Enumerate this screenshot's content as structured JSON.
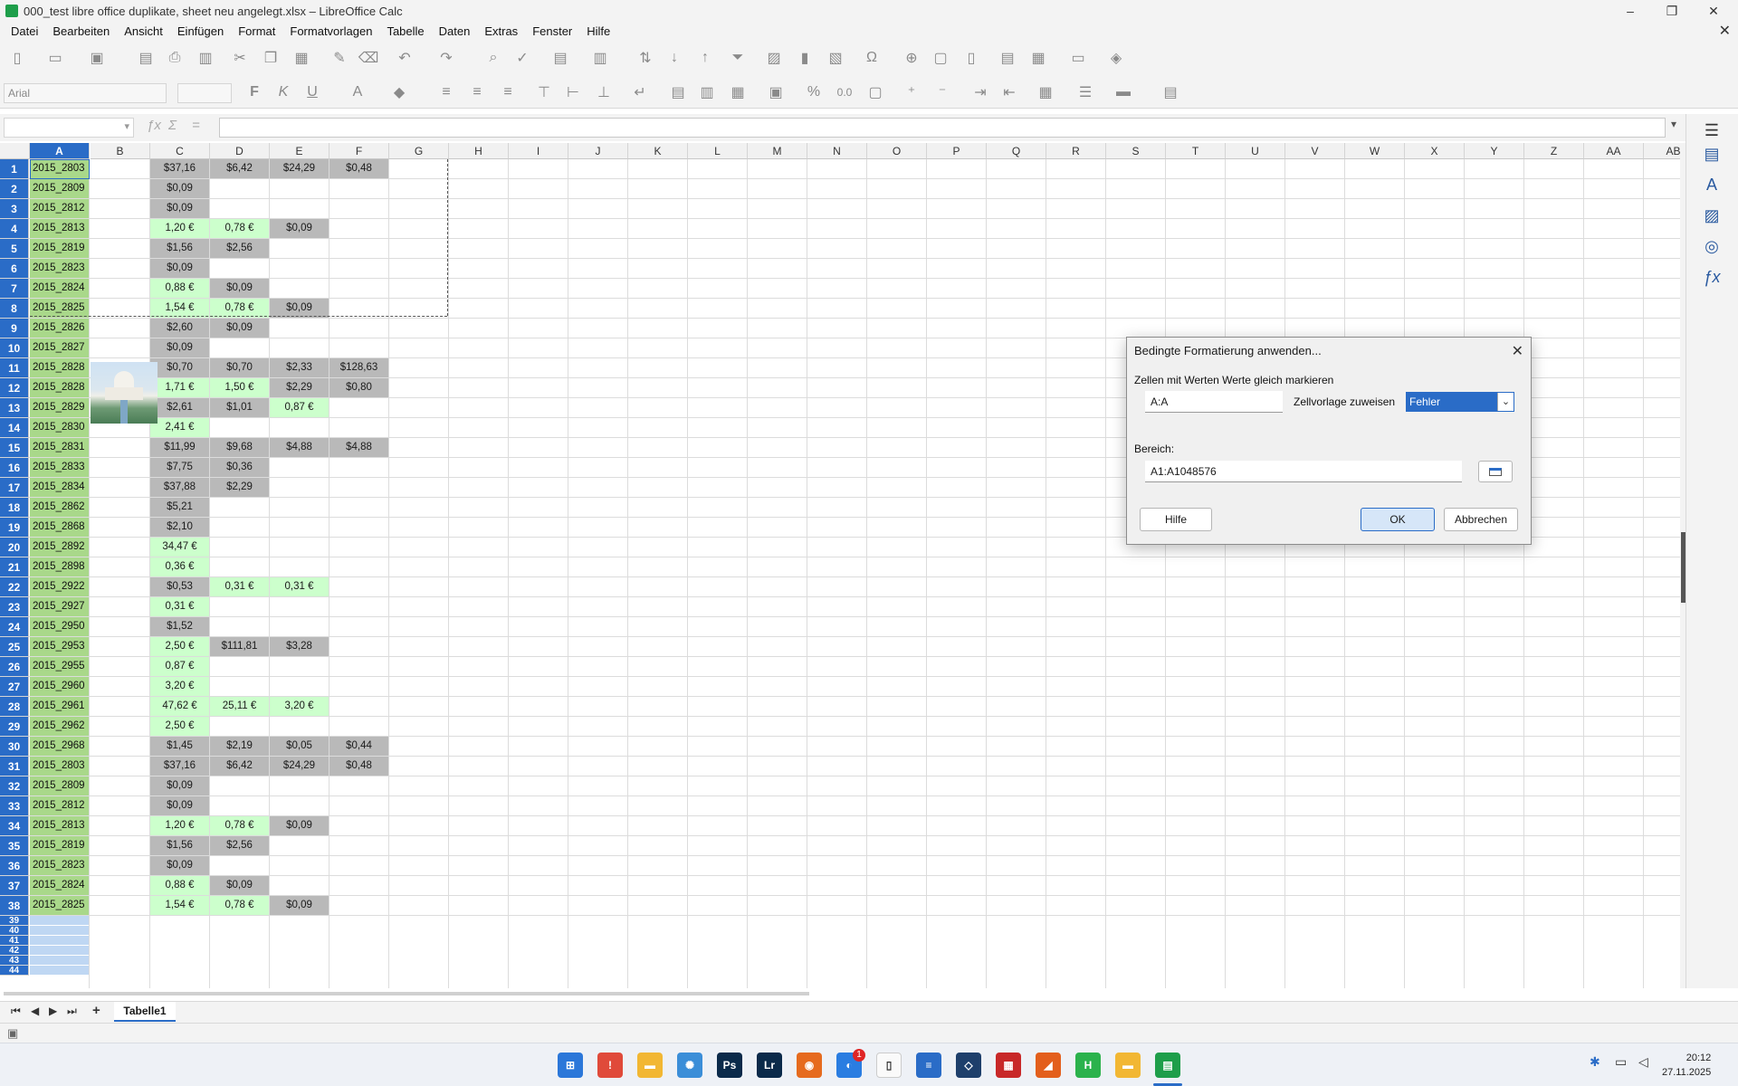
{
  "window": {
    "title": "000_test libre office duplikate, sheet neu angelegt.xlsx – LibreOffice Calc",
    "minimize": "–",
    "restore": "❐",
    "close": "✕",
    "doc_close": "✕"
  },
  "menu": [
    "Datei",
    "Bearbeiten",
    "Ansicht",
    "Einfügen",
    "Format",
    "Formatvorlagen",
    "Tabelle",
    "Daten",
    "Extras",
    "Fenster",
    "Hilfe"
  ],
  "toolbar": {
    "font_name": "Arial",
    "bold": "F",
    "italic": "K",
    "underline": "U",
    "percent": "%",
    "decimal": "0.0"
  },
  "formula_bar": {
    "name_box": "",
    "content": ""
  },
  "columns": [
    "A",
    "B",
    "C",
    "D",
    "E",
    "F",
    "G",
    "H",
    "I",
    "J",
    "K",
    "L",
    "M",
    "N",
    "O",
    "P",
    "Q",
    "R",
    "S",
    "T",
    "U",
    "V",
    "W",
    "X",
    "Y",
    "Z",
    "AA",
    "AB"
  ],
  "rows": [
    {
      "n": "1",
      "a": "2015_2803",
      "c": "$37,16",
      "d": "$6,42",
      "e": "$24,29",
      "f": "$0,48",
      "cc": "gray",
      "dc": "gray",
      "ec": "gray",
      "fc": "gray"
    },
    {
      "n": "2",
      "a": "2015_2809",
      "c": "$0,09",
      "d": "",
      "e": "",
      "f": "",
      "cc": "gray"
    },
    {
      "n": "3",
      "a": "2015_2812",
      "c": "$0,09",
      "d": "",
      "e": "",
      "f": "",
      "cc": "gray"
    },
    {
      "n": "4",
      "a": "2015_2813",
      "c": "1,20 €",
      "d": "0,78 €",
      "e": "$0,09",
      "f": "",
      "cc": "green",
      "dc": "green",
      "ec": "gray"
    },
    {
      "n": "5",
      "a": "2015_2819",
      "c": "$1,56",
      "d": "$2,56",
      "e": "",
      "f": "",
      "cc": "gray",
      "dc": "gray"
    },
    {
      "n": "6",
      "a": "2015_2823",
      "c": "$0,09",
      "d": "",
      "e": "",
      "f": "",
      "cc": "gray"
    },
    {
      "n": "7",
      "a": "2015_2824",
      "c": "0,88 €",
      "d": "$0,09",
      "e": "",
      "f": "",
      "cc": "green",
      "dc": "gray"
    },
    {
      "n": "8",
      "a": "2015_2825",
      "c": "1,54 €",
      "d": "0,78 €",
      "e": "$0,09",
      "f": "",
      "cc": "green",
      "dc": "green",
      "ec": "gray"
    },
    {
      "n": "9",
      "a": "2015_2826",
      "c": "$2,60",
      "d": "$0,09",
      "e": "",
      "f": "",
      "cc": "gray",
      "dc": "gray"
    },
    {
      "n": "10",
      "a": "2015_2827",
      "c": "$0,09",
      "d": "",
      "e": "",
      "f": "",
      "cc": "gray"
    },
    {
      "n": "11",
      "a": "2015_2828",
      "c": "$0,70",
      "d": "$0,70",
      "e": "$2,33",
      "f": "$128,63",
      "cc": "gray",
      "dc": "gray",
      "ec": "gray",
      "fc": "gray"
    },
    {
      "n": "12",
      "a": "2015_2828",
      "c": "1,71 €",
      "d": "1,50 €",
      "e": "$2,29",
      "f": "$0,80",
      "cc": "green",
      "dc": "green",
      "ec": "gray",
      "fc": "gray"
    },
    {
      "n": "13",
      "a": "2015_2829",
      "c": "$2,61",
      "d": "$1,01",
      "e": "0,87 €",
      "f": "",
      "cc": "gray",
      "dc": "gray",
      "ec": "green"
    },
    {
      "n": "14",
      "a": "2015_2830",
      "c": "2,41 €",
      "d": "",
      "e": "",
      "f": "",
      "cc": "green"
    },
    {
      "n": "15",
      "a": "2015_2831",
      "c": "$11,99",
      "d": "$9,68",
      "e": "$4,88",
      "f": "$4,88",
      "cc": "gray",
      "dc": "gray",
      "ec": "gray",
      "fc": "gray"
    },
    {
      "n": "16",
      "a": "2015_2833",
      "c": "$7,75",
      "d": "$0,36",
      "e": "",
      "f": "",
      "cc": "gray",
      "dc": "gray"
    },
    {
      "n": "17",
      "a": "2015_2834",
      "c": "$37,88",
      "d": "$2,29",
      "e": "",
      "f": "",
      "cc": "gray",
      "dc": "gray"
    },
    {
      "n": "18",
      "a": "2015_2862",
      "c": "$5,21",
      "d": "",
      "e": "",
      "f": "",
      "cc": "gray"
    },
    {
      "n": "19",
      "a": "2015_2868",
      "c": "$2,10",
      "d": "",
      "e": "",
      "f": "",
      "cc": "gray"
    },
    {
      "n": "20",
      "a": "2015_2892",
      "c": "34,47 €",
      "d": "",
      "e": "",
      "f": "",
      "cc": "green"
    },
    {
      "n": "21",
      "a": "2015_2898",
      "c": "0,36 €",
      "d": "",
      "e": "",
      "f": "",
      "cc": "green"
    },
    {
      "n": "22",
      "a": "2015_2922",
      "c": "$0,53",
      "d": "0,31 €",
      "e": "0,31 €",
      "f": "",
      "cc": "gray",
      "dc": "green",
      "ec": "green"
    },
    {
      "n": "23",
      "a": "2015_2927",
      "c": "0,31 €",
      "d": "",
      "e": "",
      "f": "",
      "cc": "green"
    },
    {
      "n": "24",
      "a": "2015_2950",
      "c": "$1,52",
      "d": "",
      "e": "",
      "f": "",
      "cc": "gray"
    },
    {
      "n": "25",
      "a": "2015_2953",
      "c": "2,50 €",
      "d": "$111,81",
      "e": "$3,28",
      "f": "",
      "cc": "green",
      "dc": "gray",
      "ec": "gray"
    },
    {
      "n": "26",
      "a": "2015_2955",
      "c": "0,87 €",
      "d": "",
      "e": "",
      "f": "",
      "cc": "green"
    },
    {
      "n": "27",
      "a": "2015_2960",
      "c": "3,20 €",
      "d": "",
      "e": "",
      "f": "",
      "cc": "green"
    },
    {
      "n": "28",
      "a": "2015_2961",
      "c": "47,62 €",
      "d": "25,11 €",
      "e": "3,20 €",
      "f": "",
      "cc": "green",
      "dc": "green",
      "ec": "green"
    },
    {
      "n": "29",
      "a": "2015_2962",
      "c": "2,50 €",
      "d": "",
      "e": "",
      "f": "",
      "cc": "green"
    },
    {
      "n": "30",
      "a": "2015_2968",
      "c": "$1,45",
      "d": "$2,19",
      "e": "$0,05",
      "f": "$0,44",
      "cc": "gray",
      "dc": "gray",
      "ec": "gray",
      "fc": "gray"
    },
    {
      "n": "31",
      "a": "2015_2803",
      "c": "$37,16",
      "d": "$6,42",
      "e": "$24,29",
      "f": "$0,48",
      "cc": "gray",
      "dc": "gray",
      "ec": "gray",
      "fc": "gray"
    },
    {
      "n": "32",
      "a": "2015_2809",
      "c": "$0,09",
      "d": "",
      "e": "",
      "f": "",
      "cc": "gray"
    },
    {
      "n": "33",
      "a": "2015_2812",
      "c": "$0,09",
      "d": "",
      "e": "",
      "f": "",
      "cc": "gray"
    },
    {
      "n": "34",
      "a": "2015_2813",
      "c": "1,20 €",
      "d": "0,78 €",
      "e": "$0,09",
      "f": "",
      "cc": "green",
      "dc": "green",
      "ec": "gray"
    },
    {
      "n": "35",
      "a": "2015_2819",
      "c": "$1,56",
      "d": "$2,56",
      "e": "",
      "f": "",
      "cc": "gray",
      "dc": "gray"
    },
    {
      "n": "36",
      "a": "2015_2823",
      "c": "$0,09",
      "d": "",
      "e": "",
      "f": "",
      "cc": "gray"
    },
    {
      "n": "37",
      "a": "2015_2824",
      "c": "0,88 €",
      "d": "$0,09",
      "e": "",
      "f": "",
      "cc": "green",
      "dc": "gray"
    },
    {
      "n": "38",
      "a": "2015_2825",
      "c": "1,54 €",
      "d": "0,78 €",
      "e": "$0,09",
      "f": "",
      "cc": "green",
      "dc": "green",
      "ec": "gray"
    }
  ],
  "empty_rows": [
    "39",
    "40",
    "41",
    "42",
    "43",
    "44"
  ],
  "sheet_tabs": {
    "active": "Tabelle1",
    "add": "+"
  },
  "dialog": {
    "title": "Bedingte Formatierung anwenden...",
    "section_label": "Zellen mit Werten Werte gleich markieren",
    "condition_value": "A:A",
    "style_label": "Zellvorlage zuweisen",
    "style_value": "Fehler",
    "range_label": "Bereich:",
    "range_value": "A1:A1048576",
    "help_button": "Hilfe",
    "ok_button": "OK",
    "cancel_button": "Abbrechen",
    "close": "✕"
  },
  "taskbar": {
    "clock_time": "20:12",
    "clock_date": "27.11.2025",
    "badge": "1"
  },
  "colors": {
    "selection_blue": "#2a6cc7",
    "col_a_green": "#a9d88a",
    "cell_gray": "#b9b9b9",
    "cell_light_green": "#ccffcc"
  }
}
